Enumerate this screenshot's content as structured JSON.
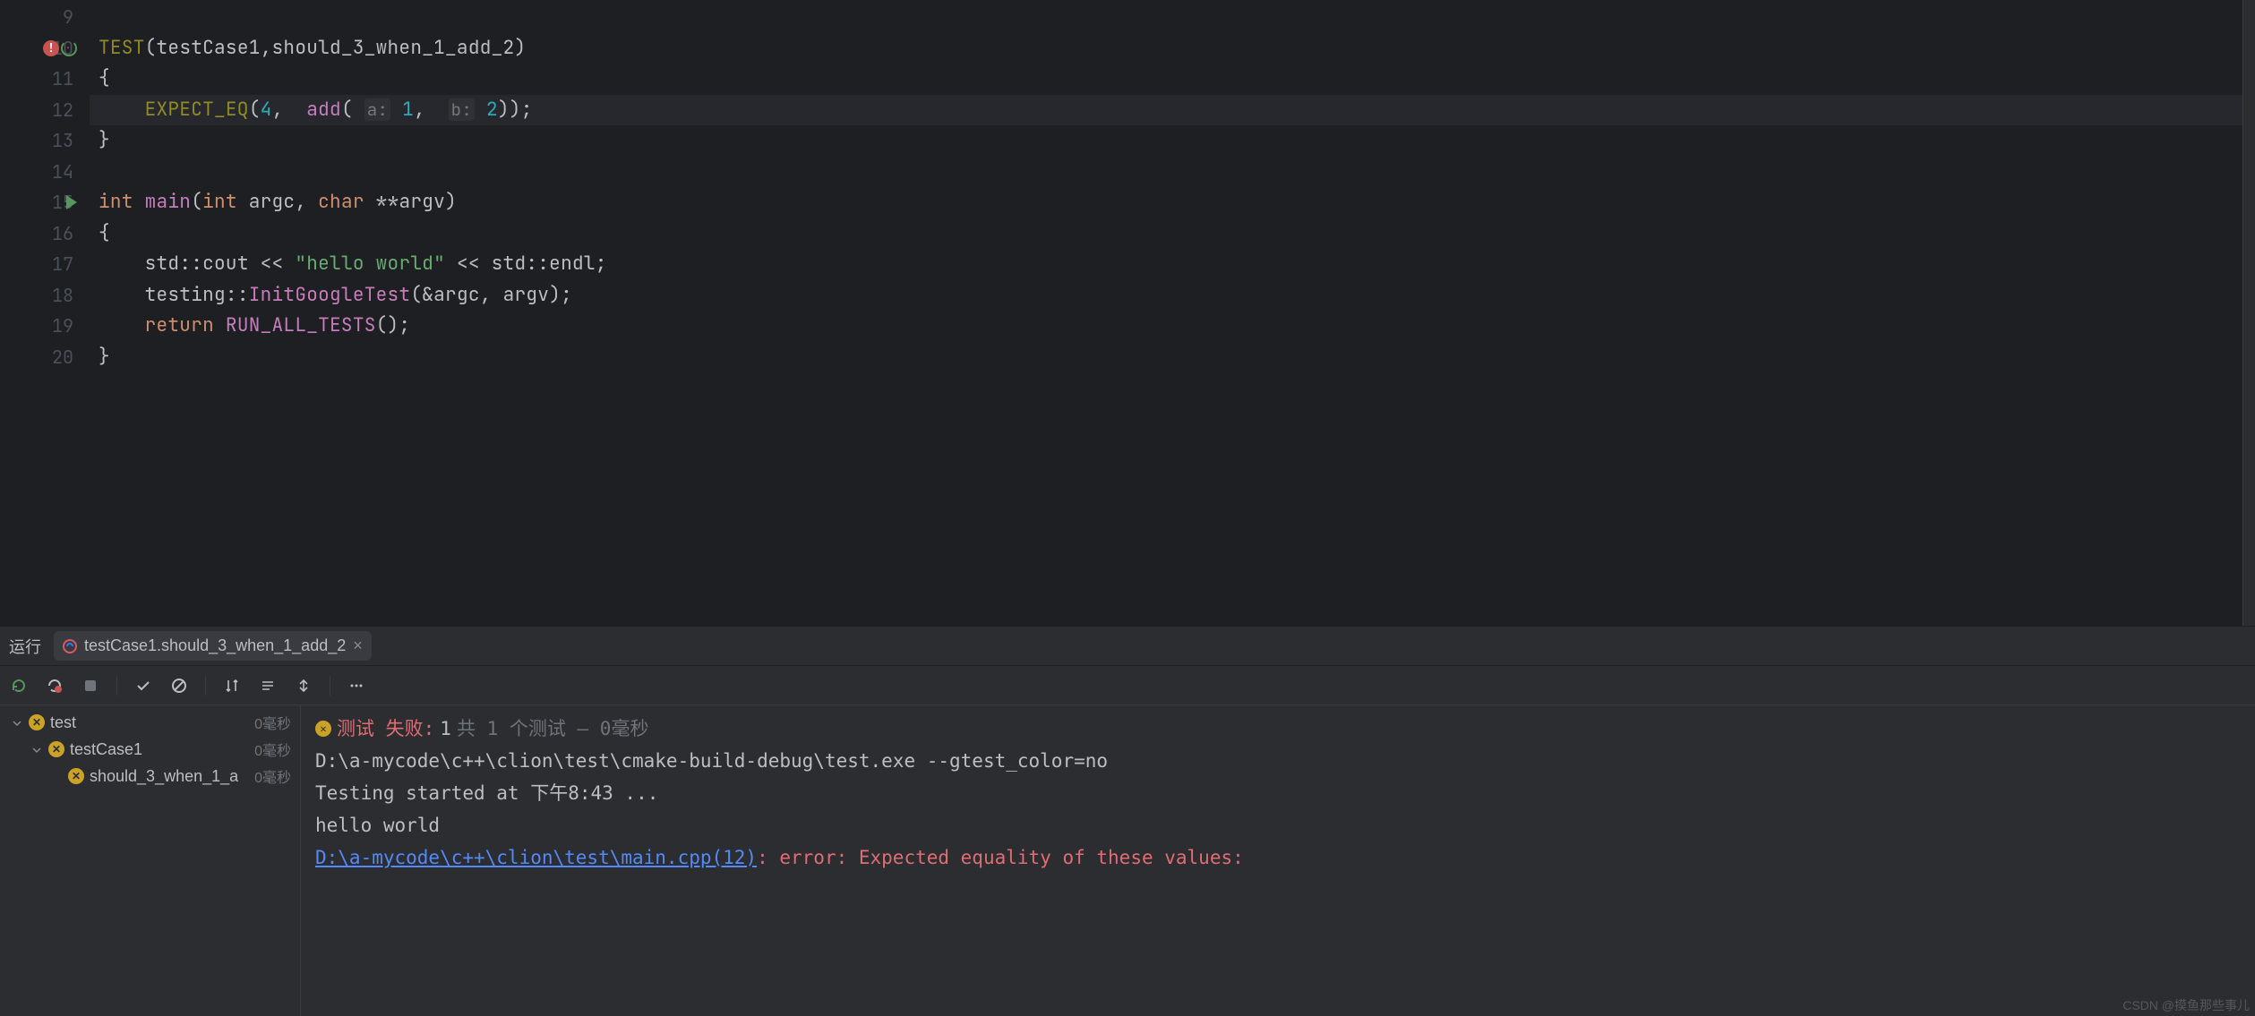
{
  "editor": {
    "lines": [
      {
        "num": "9",
        "gutter": null,
        "tokens": []
      },
      {
        "num": "10",
        "gutter": "bp-run",
        "tokens": [
          {
            "c": "macro",
            "t": "TEST"
          },
          {
            "c": "op",
            "t": "("
          },
          {
            "c": "ident",
            "t": "testCase1"
          },
          {
            "c": "op",
            "t": ","
          },
          {
            "c": "ident",
            "t": "should_3_when_1_add_2"
          },
          {
            "c": "op",
            "t": ")"
          }
        ]
      },
      {
        "num": "11",
        "gutter": null,
        "tokens": [
          {
            "c": "op",
            "t": "{"
          }
        ]
      },
      {
        "num": "12",
        "gutter": null,
        "hl": true,
        "indent": 1,
        "tokens": [
          {
            "c": "macro",
            "t": "EXPECT_EQ"
          },
          {
            "c": "op",
            "t": "("
          },
          {
            "c": "num",
            "t": "4"
          },
          {
            "c": "op",
            "t": ",  "
          },
          {
            "c": "fn",
            "t": "add"
          },
          {
            "c": "op",
            "t": "( "
          },
          {
            "c": "hint",
            "t": "a:"
          },
          {
            "c": "op",
            "t": " "
          },
          {
            "c": "num",
            "t": "1"
          },
          {
            "c": "op",
            "t": ",  "
          },
          {
            "c": "hint",
            "t": "b:"
          },
          {
            "c": "op",
            "t": " "
          },
          {
            "c": "num",
            "t": "2"
          },
          {
            "c": "op",
            "t": "));"
          }
        ]
      },
      {
        "num": "13",
        "gutter": null,
        "tokens": [
          {
            "c": "op",
            "t": "}"
          }
        ]
      },
      {
        "num": "14",
        "gutter": null,
        "tokens": []
      },
      {
        "num": "15",
        "gutter": "run",
        "tokens": [
          {
            "c": "kw",
            "t": "int"
          },
          {
            "c": "op",
            "t": " "
          },
          {
            "c": "fn",
            "t": "main"
          },
          {
            "c": "op",
            "t": "("
          },
          {
            "c": "kw",
            "t": "int"
          },
          {
            "c": "op",
            "t": " "
          },
          {
            "c": "ident",
            "t": "argc"
          },
          {
            "c": "op",
            "t": ", "
          },
          {
            "c": "kw",
            "t": "char"
          },
          {
            "c": "op",
            "t": " **"
          },
          {
            "c": "ident",
            "t": "argv"
          },
          {
            "c": "op",
            "t": ")"
          }
        ]
      },
      {
        "num": "16",
        "gutter": null,
        "tokens": [
          {
            "c": "op",
            "t": "{"
          }
        ]
      },
      {
        "num": "17",
        "gutter": null,
        "indent": 1,
        "tokens": [
          {
            "c": "ident",
            "t": "std"
          },
          {
            "c": "op",
            "t": "::"
          },
          {
            "c": "ident",
            "t": "cout"
          },
          {
            "c": "op",
            "t": " << "
          },
          {
            "c": "str",
            "t": "\"hello world\""
          },
          {
            "c": "op",
            "t": " << "
          },
          {
            "c": "ident",
            "t": "std"
          },
          {
            "c": "op",
            "t": "::"
          },
          {
            "c": "ident",
            "t": "endl"
          },
          {
            "c": "op",
            "t": ";"
          }
        ]
      },
      {
        "num": "18",
        "gutter": null,
        "indent": 1,
        "tokens": [
          {
            "c": "ident",
            "t": "testing"
          },
          {
            "c": "op",
            "t": "::"
          },
          {
            "c": "fn",
            "t": "InitGoogleTest"
          },
          {
            "c": "op",
            "t": "(&"
          },
          {
            "c": "ident",
            "t": "argc"
          },
          {
            "c": "op",
            "t": ", "
          },
          {
            "c": "ident",
            "t": "argv"
          },
          {
            "c": "op",
            "t": ");"
          }
        ]
      },
      {
        "num": "19",
        "gutter": null,
        "indent": 1,
        "tokens": [
          {
            "c": "kw",
            "t": "return"
          },
          {
            "c": "op",
            "t": " "
          },
          {
            "c": "fn",
            "t": "RUN_ALL_TESTS"
          },
          {
            "c": "op",
            "t": "();"
          }
        ]
      },
      {
        "num": "20",
        "gutter": null,
        "tokens": [
          {
            "c": "op",
            "t": "}"
          }
        ]
      }
    ]
  },
  "panel": {
    "run_label": "运行",
    "tab_name": "testCase1.should_3_when_1_add_2",
    "test_failed_label": "测试 失败:",
    "test_count": "1",
    "test_total_label": "共 1 个测试 – 0毫秒",
    "tree": [
      {
        "depth": 0,
        "name": "test",
        "time": "0毫秒",
        "expandable": true
      },
      {
        "depth": 1,
        "name": "testCase1",
        "time": "0毫秒",
        "expandable": true
      },
      {
        "depth": 2,
        "name": "should_3_when_1_a",
        "time": "0毫秒",
        "expandable": false
      }
    ],
    "console": {
      "cmd": "D:\\a-mycode\\c++\\clion\\test\\cmake-build-debug\\test.exe --gtest_color=no",
      "start": "Testing started at 下午8:43 ...",
      "hello": "hello world",
      "link": "D:\\a-mycode\\c++\\clion\\test\\main.cpp(12)",
      "error": ": error: Expected equality of these values:"
    }
  },
  "watermark": "CSDN @摸鱼那些事儿"
}
